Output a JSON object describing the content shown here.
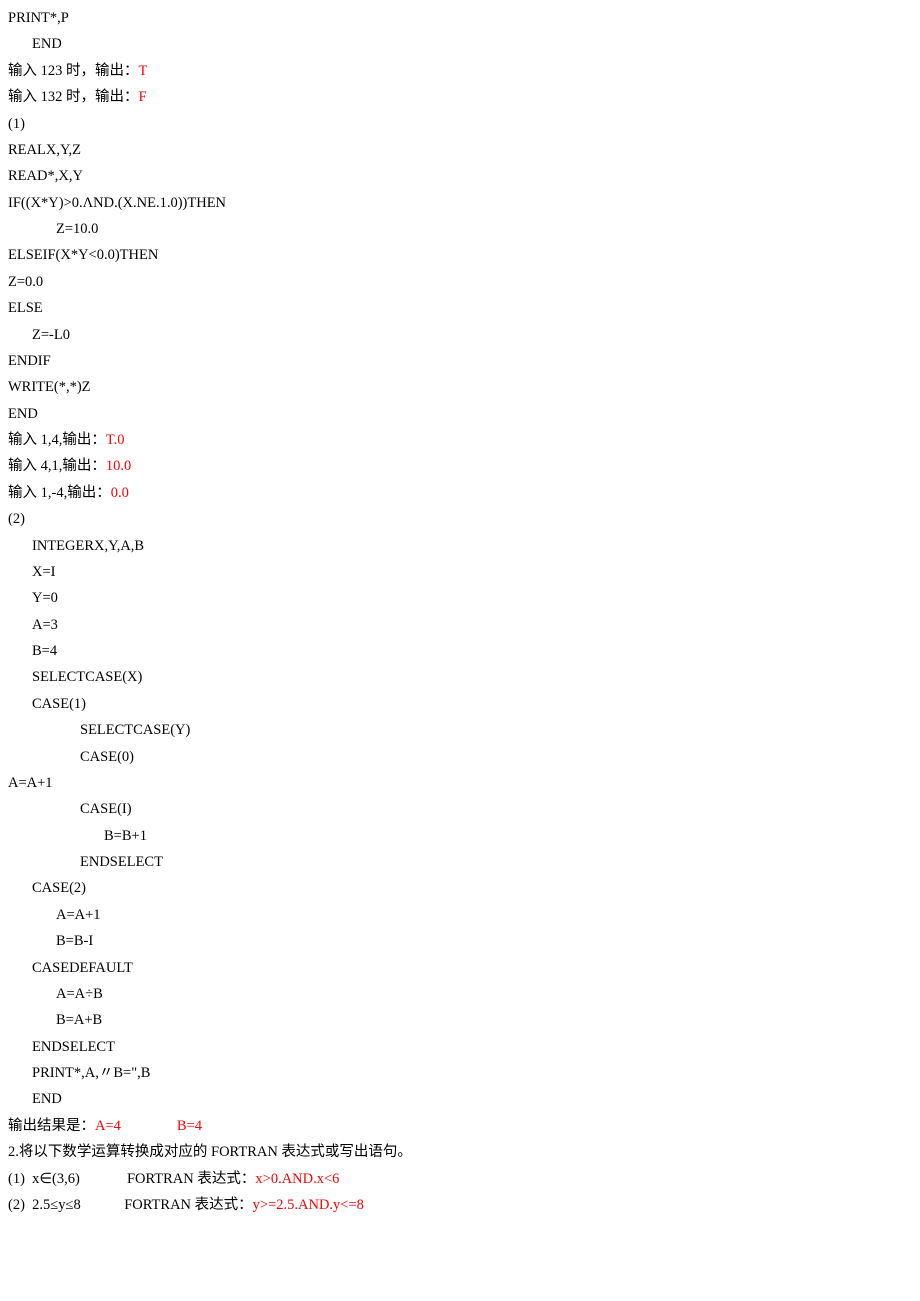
{
  "lines": [
    {
      "cls": "line",
      "text": "PRINT*,P"
    },
    {
      "cls": "line ind1",
      "text": "END"
    },
    {
      "cls": "line",
      "text": "输入 123 时，输出：",
      "red": "T"
    },
    {
      "cls": "line",
      "text": "输入 132 时，输出：",
      "red": "F"
    },
    {
      "cls": "line",
      "text": "(1)"
    },
    {
      "cls": "line",
      "text": "REALX,Y,Z"
    },
    {
      "cls": "line",
      "text": "READ*,X,Y"
    },
    {
      "cls": "line",
      "text": "IF((X*Y)>0.ΛND.(X.NE.1.0))THEN"
    },
    {
      "cls": "line ind2",
      "text": "Z=10.0"
    },
    {
      "cls": "line",
      "text": "ELSEIF(X*Y<0.0)THEN"
    },
    {
      "cls": "line",
      "text": "Z=0.0"
    },
    {
      "cls": "line",
      "text": "ELSE"
    },
    {
      "cls": "line ind1",
      "text": "Z=-L0"
    },
    {
      "cls": "line",
      "text": "ENDIF"
    },
    {
      "cls": "line",
      "text": "WRITE(*,*)Z"
    },
    {
      "cls": "line",
      "text": "END"
    },
    {
      "cls": "line",
      "text": "输入 1,4,输出：",
      "red": "T.0"
    },
    {
      "cls": "line",
      "text": "输入 4,1,输出：",
      "red": "10.0"
    },
    {
      "cls": "line",
      "text": "输入 1,-4,输出：",
      "red": "0.0"
    },
    {
      "cls": "line",
      "text": "(2)"
    },
    {
      "cls": "line ind1",
      "text": "INTEGERX,Y,A,B"
    },
    {
      "cls": "line ind1",
      "text": "X=I"
    },
    {
      "cls": "line ind1",
      "text": "Y=0"
    },
    {
      "cls": "line ind1",
      "text": "A=3"
    },
    {
      "cls": "line ind1",
      "text": "B=4"
    },
    {
      "cls": "line ind1",
      "text": "SELECTCASE(X)"
    },
    {
      "cls": "line ind1",
      "text": "CASE(1)"
    },
    {
      "cls": "line ind3",
      "text": "SELECTCASE(Y)"
    },
    {
      "cls": "line ind3",
      "text": "CASE(0)"
    },
    {
      "cls": "line",
      "text": "A=A+1"
    },
    {
      "cls": "line ind3",
      "text": "CASE(I)"
    },
    {
      "cls": "line ind4",
      "text": "B=B+1"
    },
    {
      "cls": "line ind3",
      "text": "ENDSELECT"
    },
    {
      "cls": "line ind1",
      "text": "CASE(2)"
    },
    {
      "cls": "line ind2",
      "text": "A=A+1"
    },
    {
      "cls": "line ind2",
      "text": "B=B-I"
    },
    {
      "cls": "line ind1",
      "text": "CASEDEFAULT"
    },
    {
      "cls": "line ind2",
      "text": "A=A÷B"
    },
    {
      "cls": "line ind2",
      "text": "B=A+B"
    },
    {
      "cls": "line ind1",
      "text": "ENDSELECT"
    },
    {
      "cls": "line ind1",
      "text": "PRINT*,A,〃B=\",B"
    },
    {
      "cls": "line ind1",
      "text": "END"
    },
    {
      "cls": "line",
      "text": "输出结果是：",
      "red": "A=4",
      "gap": true,
      "red2": "B=4"
    },
    {
      "cls": "line",
      "text": "2.将以下数学运算转换成对应的 FORTRAN 表达式或写出语句。"
    },
    {
      "cls": "line",
      "text": "(1)  x∈(3,6)             FORTRAN 表达式：",
      "red": "x>0.AND.x<6"
    },
    {
      "cls": "line",
      "text": "(2)  2.5≤y≤8            FORTRAN 表达式：",
      "red": "y>=2.5.AND.y<=8"
    }
  ]
}
